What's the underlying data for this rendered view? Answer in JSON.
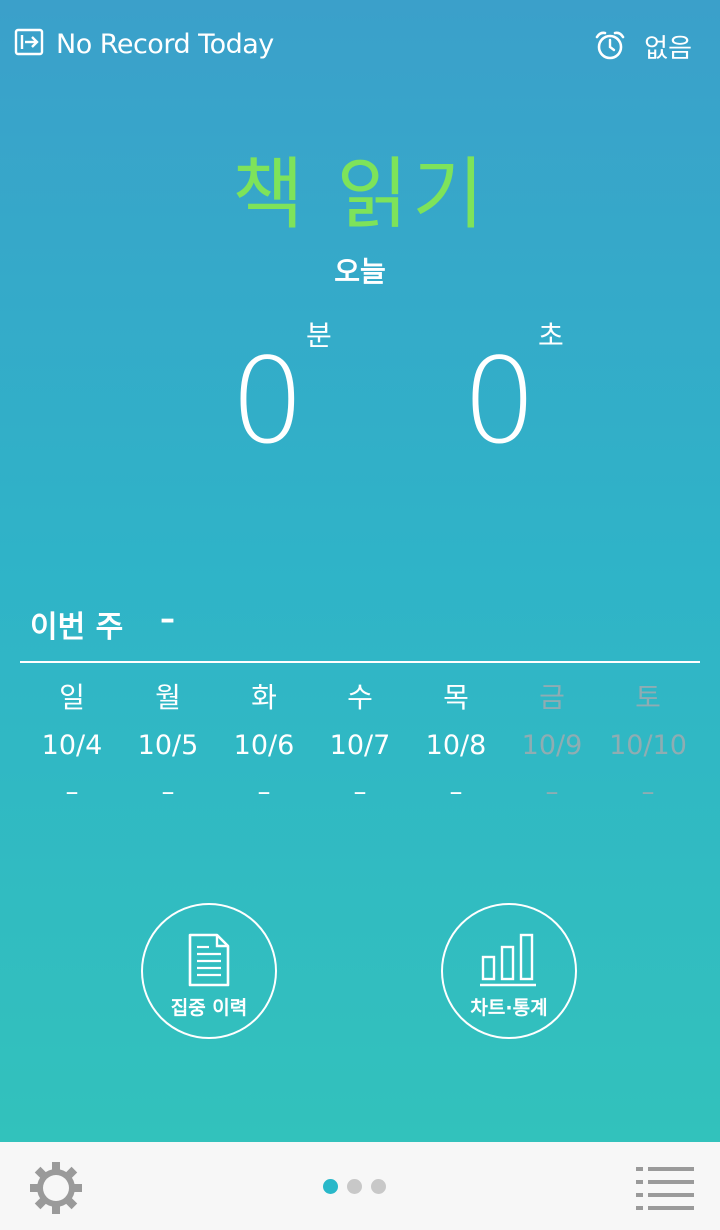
{
  "header": {
    "record_label": "No Record Today",
    "alarm_label": "없음"
  },
  "main": {
    "title": "책 읽기",
    "today_label": "오늘",
    "minutes": "0",
    "minutes_unit": "분",
    "seconds": "0",
    "seconds_unit": "초"
  },
  "week": {
    "label": "이번 주",
    "value": "–",
    "days": [
      {
        "name": "일",
        "date": "10/4",
        "value": "–"
      },
      {
        "name": "월",
        "date": "10/5",
        "value": "–"
      },
      {
        "name": "화",
        "date": "10/6",
        "value": "–"
      },
      {
        "name": "수",
        "date": "10/7",
        "value": "–"
      },
      {
        "name": "목",
        "date": "10/8",
        "value": "–"
      },
      {
        "name": "금",
        "date": "10/9",
        "value": "–"
      },
      {
        "name": "토",
        "date": "10/10",
        "value": "–"
      }
    ]
  },
  "actions": {
    "history_label": "집중 이력",
    "stats_label": "차트·통계"
  },
  "colors": {
    "title": "#7ee35a",
    "gradient_top": "#3ba0ca",
    "gradient_bottom": "#33c4ba",
    "active_dot": "#29b8c9",
    "future_day": "#a0aaaf"
  },
  "icons": {
    "record": "exit-arrow-icon",
    "alarm": "alarm-clock-icon",
    "history": "document-icon",
    "stats": "bar-chart-icon",
    "settings": "gear-icon",
    "menu": "list-menu-icon"
  },
  "pager": {
    "pages": 3,
    "current": 1
  }
}
